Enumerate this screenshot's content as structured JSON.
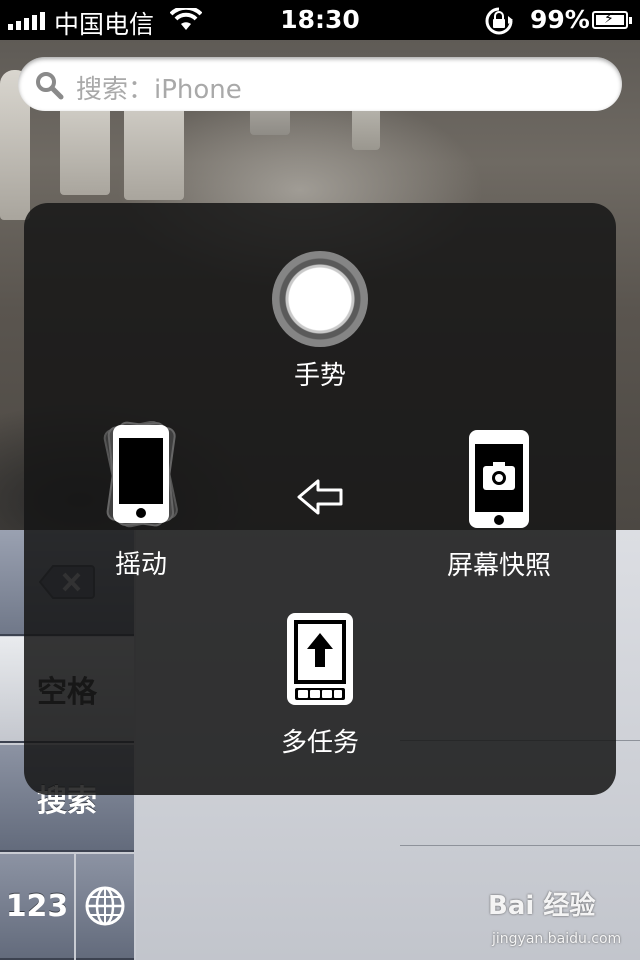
{
  "status_bar": {
    "carrier": "中国电信",
    "time": "18:30",
    "battery_percent": "99%",
    "signal_icon": "signal-bars-icon",
    "wifi_icon": "wifi-icon",
    "orientation_lock_icon": "rotation-lock-icon",
    "battery_icon": "battery-charging-icon"
  },
  "search": {
    "placeholder": "搜索：iPhone",
    "icon": "search-icon"
  },
  "assistive_touch": {
    "gesture_label": "手势",
    "shake_label": "摇动",
    "screenshot_label": "屏幕快照",
    "multitask_label": "多任务",
    "back_icon": "back-arrow-icon"
  },
  "keyboard": {
    "delete_icon": "delete-key-icon",
    "space_label": "空格",
    "search_label": "搜索",
    "numbers_label": "123",
    "globe_icon": "globe-icon"
  },
  "watermark": {
    "brand": "Bai 经验",
    "url": "jingyan.baidu.com"
  }
}
